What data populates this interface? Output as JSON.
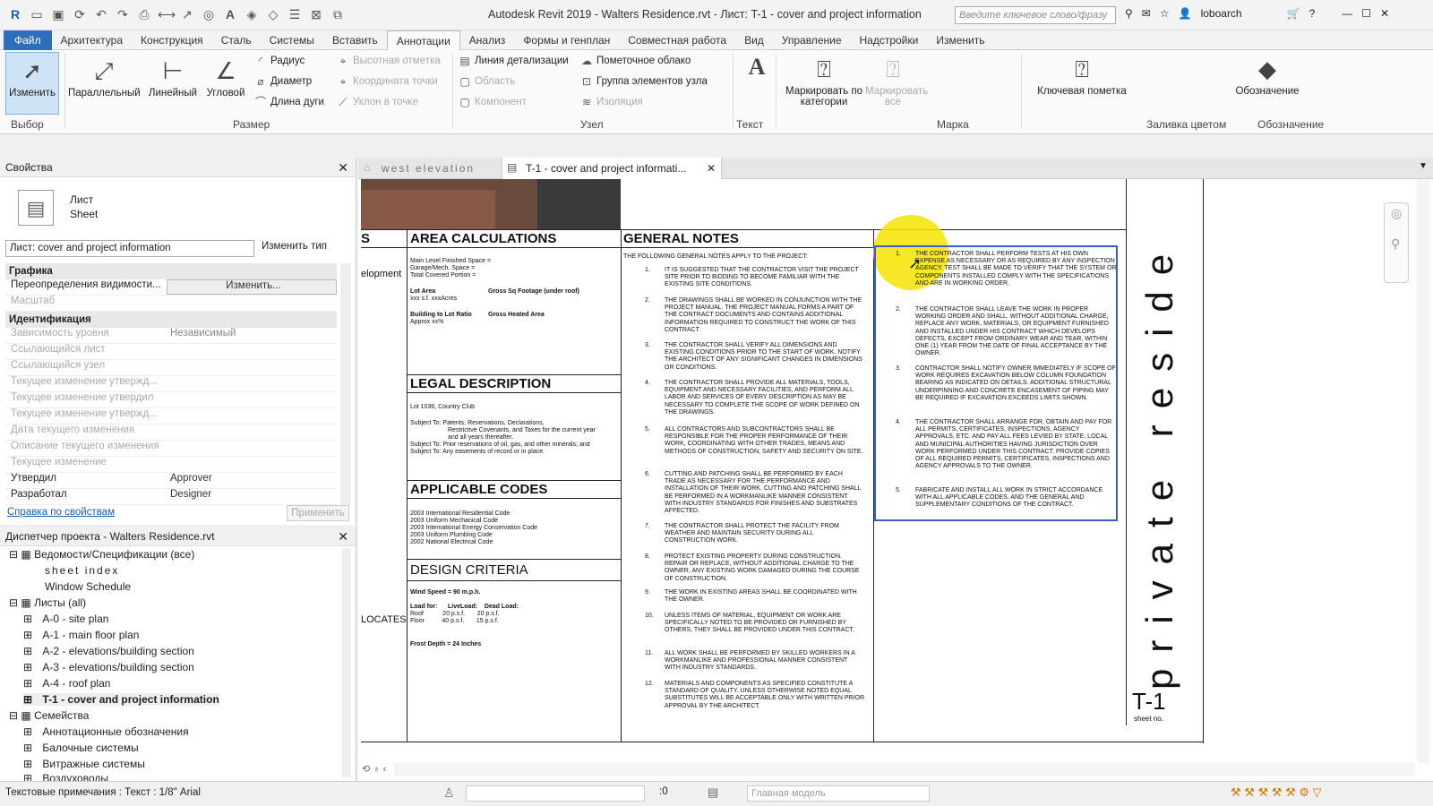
{
  "app": {
    "title": "Autodesk Revit 2019 - Walters Residence.rvt - Лист: T-1 - cover and project information",
    "search_placeholder": "Введите ключевое слово/фразу",
    "user": "loboarch"
  },
  "menu": [
    "Файл",
    "Архитектура",
    "Конструкция",
    "Сталь",
    "Системы",
    "Вставить",
    "Аннотации",
    "Анализ",
    "Формы и генплан",
    "Совместная работа",
    "Вид",
    "Управление",
    "Надстройки",
    "Изменить"
  ],
  "ribbon": {
    "modify": "Изменить",
    "parallel": "Параллельный",
    "linear": "Линейный",
    "angular": "Угловой",
    "radius": "Радиус",
    "diameter": "Диаметр",
    "arc_length": "Длина дуги",
    "spot_elevation": "Высотная отметка",
    "spot_coordinate": "Координата точки",
    "spot_slope": "Уклон в точке",
    "detail_line": "Линия детализации",
    "region": "Область",
    "component": "Компонент",
    "revision_cloud": "Пометочное облако",
    "detail_group": "Группа элементов узла",
    "insulation": "Изоляция",
    "text_label": "Текст",
    "tag_by_category": "Маркировать по категории",
    "tag_all": "Маркировать все",
    "keynote": "Ключевая пометка",
    "symbol": "Обозначение",
    "panels": {
      "select": "Выбор",
      "dimension": "Размер",
      "detail": "Узел",
      "text": "Текст",
      "tag": "Марка",
      "color_fill": "Заливка цветом",
      "symbol": "Обозначение"
    }
  },
  "properties": {
    "title": "Свойства",
    "type_name": "Лист",
    "type_sub": "Sheet",
    "selector": "Лист: cover and project information",
    "edit_type": "Изменить тип",
    "group_graphics": "Графика",
    "group_identity": "Идентификация",
    "rows": [
      {
        "k": "Переопределения видимости...",
        "v": "Изменить..."
      },
      {
        "k": "Масштаб",
        "v": ""
      },
      {
        "k": "Зависимость уровня",
        "v": "Независимый"
      },
      {
        "k": "Ссылающийся лист",
        "v": ""
      },
      {
        "k": "Ссылающийся узел",
        "v": ""
      },
      {
        "k": "Текущее изменение утвержд...",
        "v": ""
      },
      {
        "k": "Текущее изменение утвердил",
        "v": ""
      },
      {
        "k": "Текущее изменение утвержд...",
        "v": ""
      },
      {
        "k": "Дата текущего изменения",
        "v": ""
      },
      {
        "k": "Описание текущего изменения",
        "v": ""
      },
      {
        "k": "Текущее изменение",
        "v": ""
      },
      {
        "k": "Утвердил",
        "v": "Approver"
      },
      {
        "k": "Разработал",
        "v": "Designer"
      }
    ],
    "help_link": "Справка по свойствам",
    "apply": "Применить"
  },
  "browser": {
    "title": "Диспетчер проекта - Walters Residence.rvt",
    "nodes": [
      "Ведомости/Спецификации (все)",
      "sheet index",
      "Window Schedule",
      "Листы (all)",
      "A-0 - site plan",
      "A-1 - main floor plan",
      "A-2 - elevations/building section",
      "A-3 - elevations/building section",
      "A-4 - roof plan",
      "T-1 - cover and project information",
      "Семейства",
      "Аннотационные обозначения",
      "Балочные системы",
      "Витражные системы",
      "Воздуховоды"
    ]
  },
  "tabs": [
    "west elevation",
    "T-1 - cover and project informati..."
  ],
  "sheet": {
    "area_calc": "AREA CALCULATIONS",
    "area_lines": [
      "Main Level Finished Space =",
      "Garage/Mech. Space =",
      "Total Covered Portion ="
    ],
    "lot_area": "Lot Area",
    "lot_area_val": "xxx s.f.      xxxAcres",
    "gross_fp": "Gross Sq Footage (under roof)",
    "bldg_lot": "Building to Lot Ratio",
    "bldg_lot_val": "Approx xx%",
    "gross_heated": "Gross Heated Area",
    "legal": "LEGAL DESCRIPTION",
    "legal_lot": "Lot 1036, Country Club",
    "legal_lines": [
      "Subject To:  Patents, Reservations, Declarations,",
      "Restrictive Covenants, and Taxes for the current year",
      "and all years thereafter.",
      "Subject To:  Prior reservations of oil, gas, and other minerals; and",
      "Subject To:  Any easements of record or in place."
    ],
    "codes": "APPLICABLE CODES",
    "codes_lines": [
      "2003 International Residential Code",
      "2003 Uniform Mechanical Code",
      "2003 International Energy Conservation Code",
      "2003 Uniform Plumbing Code",
      "2002 National Electrical Code"
    ],
    "design": "DESIGN CRITERIA",
    "wind": "Wind Speed = 90 m.p.h.",
    "loadfor": "Load for:      LiveLoad:    Dead Load:",
    "roof1": "Roof           20 p.s.f.       20 p.s.f.",
    "floor1": "Floor          40 p.s.f.       15 p.s.f.",
    "frost": "Frost Depth = 24 Inches",
    "s_frag": "S",
    "elopment": "elopment",
    "locates": "LOCATES",
    "general": "GENERAL NOTES",
    "gn_intro": "THE FOLLOWING GENERAL NOTES APPLY TO THE PROJECT:",
    "notes": [
      "IT IS SUGGESTED THAT THE CONTRACTOR VISIT THE PROJECT SITE PRIOR TO BIDDING TO BECOME FAMILIAR WITH THE EXISTING SITE CONDITIONS.",
      "THE DRAWINGS SHALL BE WORKED IN CONJUNCTION WITH THE PROJECT MANUAL. THE PROJECT MANUAL FORMS A PART OF THE CONTRACT DOCUMENTS AND CONTAINS ADDITIONAL INFORMATION REQUIRED TO CONSTRUCT THE WORK OF THIS CONTRACT.",
      "THE CONTRACTOR SHALL VERIFY ALL DIMENSIONS AND EXISTING CONDITIONS PRIOR TO THE START OF WORK. NOTIFY THE ARCHITECT OF ANY SIGNIFICANT CHANGES IN DIMENSIONS OR CONDITIONS.",
      "THE CONTRACTOR SHALL PROVIDE ALL MATERIALS, TOOLS, EQUIPMENT AND NECESSARY FACILITIES, AND PERFORM ALL LABOR AND SERVICES OF EVERY DESCRIPTION AS MAY BE NECESSARY TO COMPLETE THE SCOPE OF WORK DEFINED ON THE DRAWINGS.",
      "ALL CONTRACTORS AND SUBCONTRACTORS SHALL BE RESPONSIBLE FOR THE PROPER PERFORMANCE OF THEIR WORK, COORDINATING WITH OTHER TRADES, MEANS AND METHODS OF CONSTRUCTION, SAFETY AND SECURITY ON SITE.",
      "CUTTING AND PATCHING SHALL BE PERFORMED BY EACH TRADE AS NECESSARY FOR THE PERFORMANCE AND INSTALLATION OF THEIR WORK. CUTTING AND PATCHING SHALL BE PERFORMED IN A WORKMANLIKE MANNER CONSISTENT WITH INDUSTRY STANDARDS FOR FINISHES AND SUBSTRATES AFFECTED.",
      "THE CONTRACTOR SHALL PROTECT THE FACILITY FROM WEATHER AND MAINTAIN SECURITY DURING ALL CONSTRUCTION WORK.",
      "PROTECT EXISTING PROPERTY DURING CONSTRUCTION. REPAIR OR REPLACE, WITHOUT ADDITIONAL CHARGE TO THE OWNER, ANY EXISTING WORK DAMAGED DURING THE COURSE OF CONSTRUCTION.",
      "THE WORK IN EXISTING AREAS SHALL BE COORDINATED WITH THE OWNER.",
      "UNLESS ITEMS OF MATERIAL, EQUIPMENT OR WORK ARE SPECIFICALLY NOTED TO BE PROVIDED OR FURNISHED BY OTHERS, THEY SHALL BE PROVIDED UNDER THIS CONTRACT.",
      "ALL WORK SHALL BE PERFORMED BY SKILLED WORKERS IN A WORKMANLIKE AND PROFESSIONAL MANNER CONSISTENT WITH INDUSTRY STANDARDS.",
      "MATERIALS AND COMPONENTS AS SPECIFIED CONSTITUTE A STANDARD OF QUALITY. UNLESS OTHERWISE NOTED EQUAL SUBSTITUTES WILL BE ACCEPTABLE ONLY WITH WRITTEN PRIOR APPROVAL BY THE ARCHITECT."
    ],
    "notes2": [
      "THE CONTRACTOR SHALL PERFORM TESTS AT HIS OWN EXPENSE AS NECESSARY OR AS REQUIRED BY ANY INSPECTION AGENCY. TEST SHALL BE MADE TO VERIFY THAT THE SYSTEM OR COMPONENTS INSTALLED COMPLY WITH THE SPECIFICATIONS AND ARE IN WORKING ORDER.",
      "THE CONTRACTOR SHALL LEAVE THE WORK IN PROPER WORKING ORDER AND SHALL, WITHOUT ADDITIONAL CHARGE, REPLACE ANY WORK, MATERIALS, OR EQUIPMENT FURNISHED AND INSTALLED UNDER HIS CONTRACT WHICH DEVELOPS DEFECTS, EXCEPT FROM ORDINARY WEAR AND TEAR, WITHIN ONE (1) YEAR FROM THE DATE OF FINAL ACCEPTANCE BY THE OWNER.",
      "CONTRACTOR SHALL NOTIFY OWNER IMMEDIATELY IF SCOPE OF WORK REQUIRES EXCAVATION BELOW COLUMN FOUNDATION BEARING AS INDICATED ON DETAILS. ADDITIONAL STRUCTURAL UNDERPINNING AND CONCRETE ENCASEMENT OF PIPING MAY BE REQUIRED IF EXCAVATION EXCEEDS LIMITS SHOWN.",
      "THE CONTRACTOR SHALL ARRANGE FOR, OBTAIN AND PAY FOR ALL PERMITS, CERTIFICATES, INSPECTIONS, AGENCY APPROVALS, ETC. AND PAY ALL FEES LEVIED BY STATE, LOCAL AND MUNICIPAL AUTHORITIES HAVING JURISDICTION OVER WORK PERFORMED UNDER THIS CONTRACT. PROVIDE COPIES OF ALL REQUIRED PERMITS, CERTIFICATES, INSPECTIONS AND AGENCY APPROVALS TO THE OWNER.",
      "FABRICATE AND INSTALL ALL WORK IN STRICT ACCORDANCE WITH ALL APPLICABLE CODES, AND THE GENERAL AND SUPPLEMENTARY CONDITIONS OF THE CONTRACT."
    ],
    "vertical_title": "private reside",
    "sheet_number": "T-1",
    "sheet_no_label": "sheet no."
  },
  "status": {
    "text": "Текстовые примечания : Текст : 1/8\" Arial",
    "model": "Главная модель",
    "count": ":0"
  },
  "colors": {
    "file_blue": "#2e6fbd",
    "highlight_yellow": "#f5e400",
    "select_blue": "#3a5fcd"
  }
}
